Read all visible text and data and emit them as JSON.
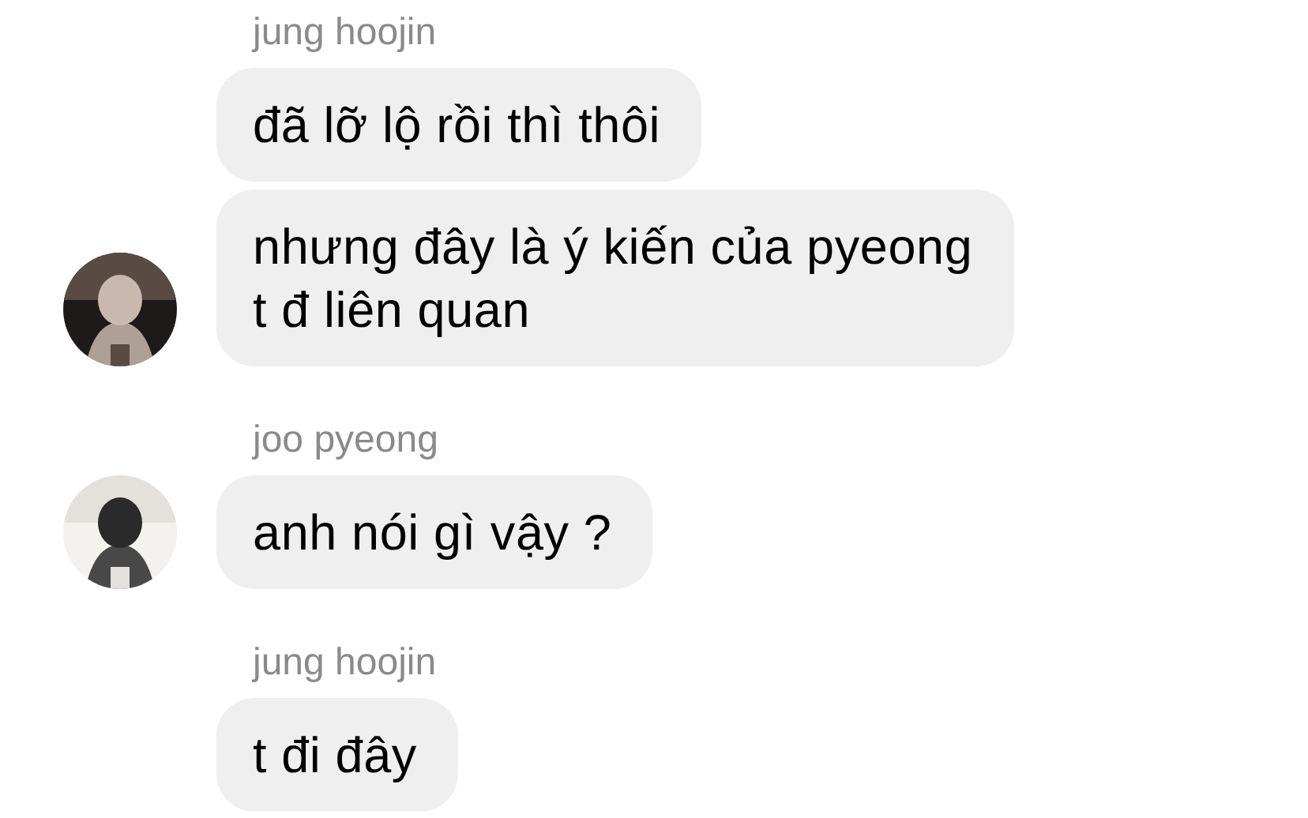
{
  "groups": [
    {
      "sender": "jung hoojin",
      "messages": [
        {
          "text": "đã lỡ lộ rồi thì thôi"
        },
        {
          "text": "nhưng đây là ý kiến của pyeong\nt đ liên quan"
        }
      ]
    },
    {
      "sender": "joo pyeong",
      "messages": [
        {
          "text": "anh nói gì vậy ?"
        }
      ]
    },
    {
      "sender": "jung hoojin",
      "messages": [
        {
          "text": "t đi đây"
        }
      ]
    }
  ]
}
